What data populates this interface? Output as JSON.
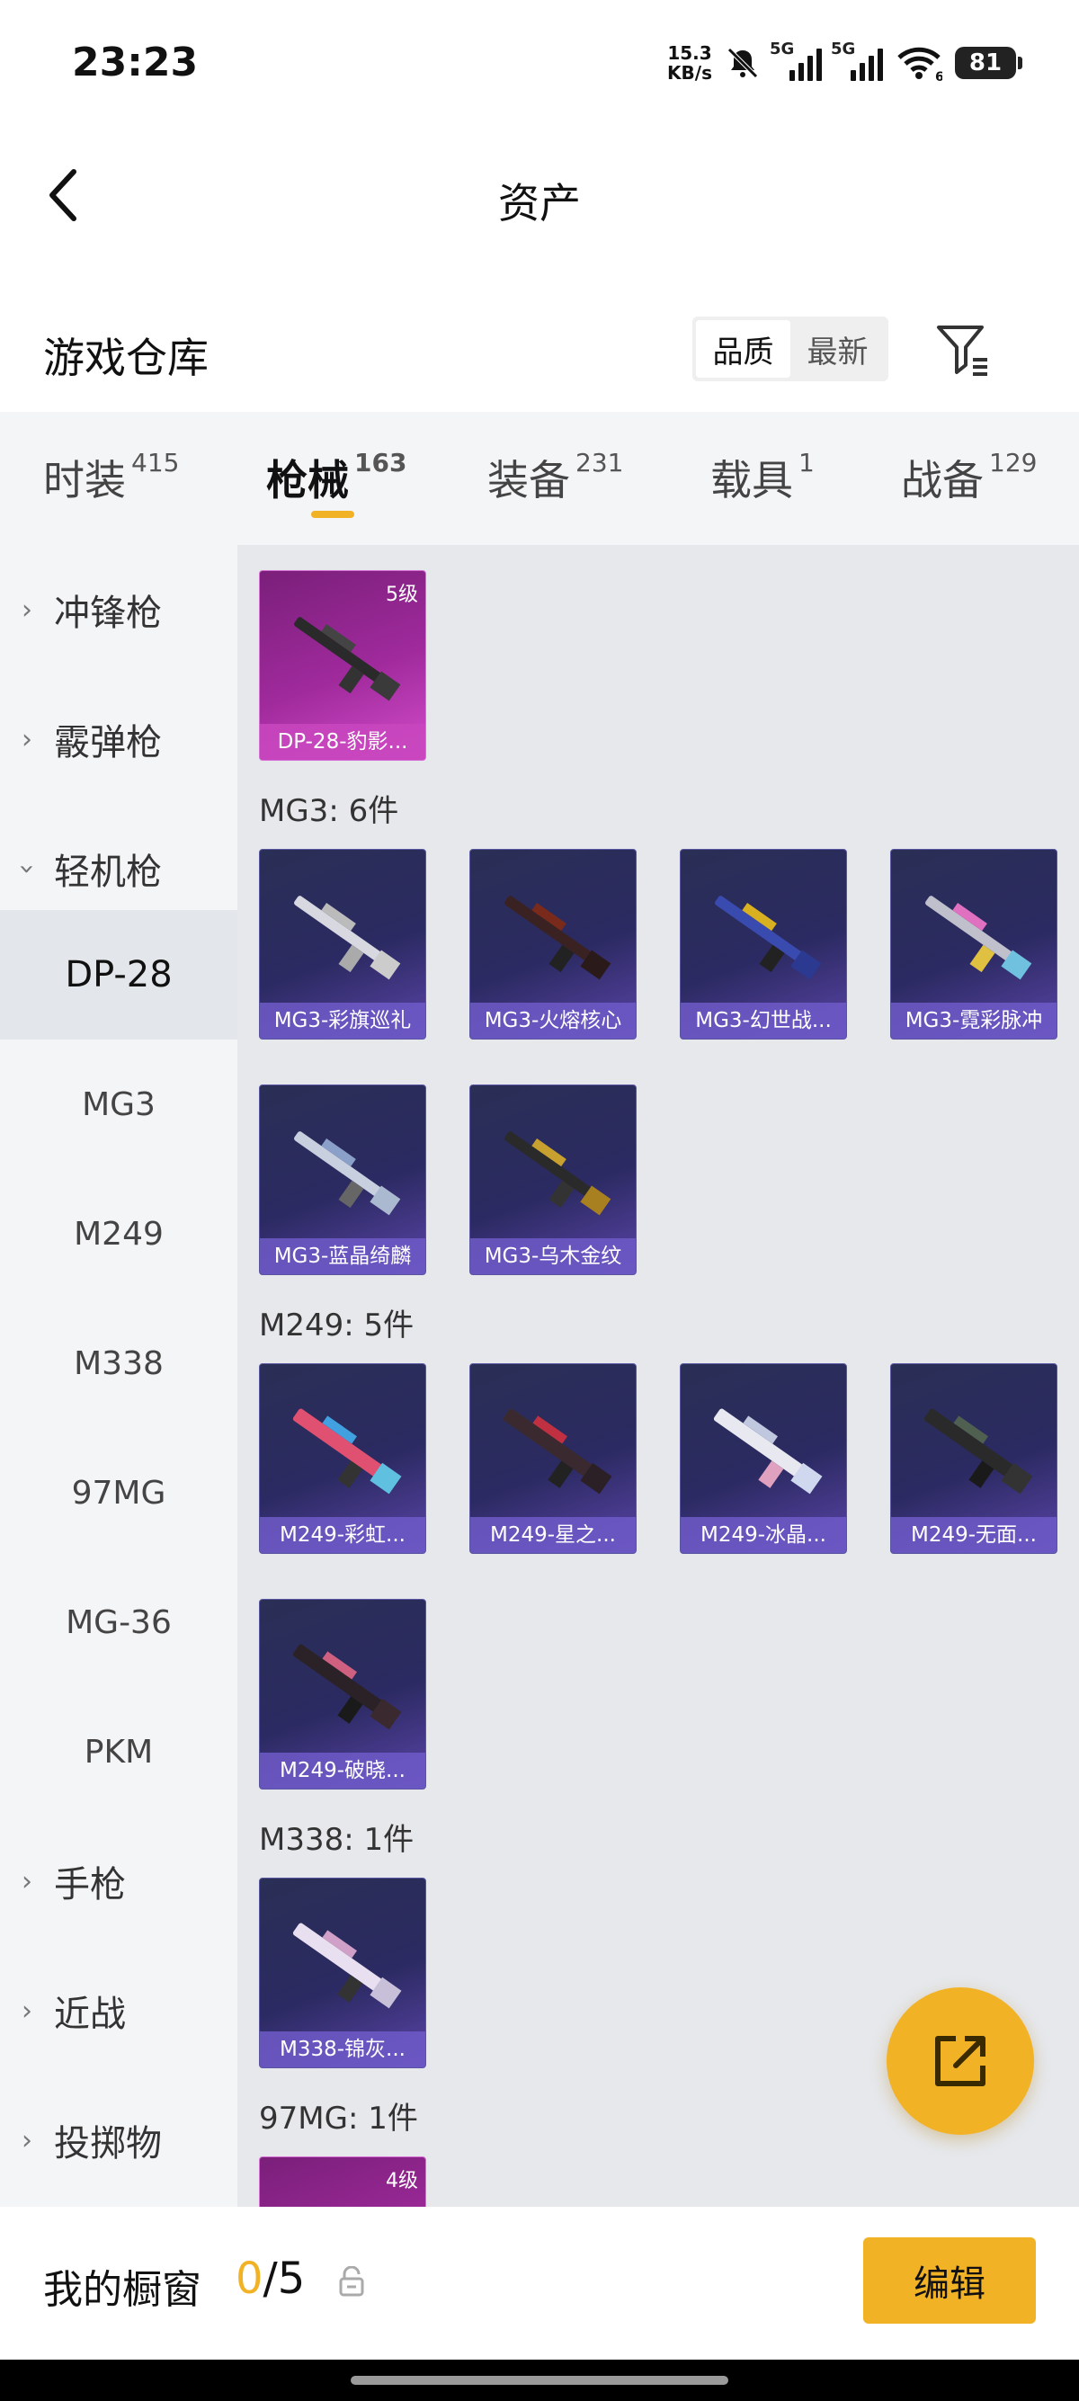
{
  "status": {
    "time": "23:23",
    "net_speed": "15.3",
    "net_unit": "KB/s",
    "signal1_label": "5G",
    "signal2_label": "5G",
    "wifi_label": "6",
    "battery": "81"
  },
  "header": {
    "title": "资产"
  },
  "warehouse": {
    "title": "游戏仓库",
    "sort_options": [
      "品质",
      "最新"
    ]
  },
  "tabs": [
    {
      "label": "时装",
      "count": "415"
    },
    {
      "label": "枪械",
      "count": "163"
    },
    {
      "label": "装备",
      "count": "231"
    },
    {
      "label": "载具",
      "count": "1"
    },
    {
      "label": "战备",
      "count": "129"
    }
  ],
  "sidebar": {
    "categories_top": [
      "冲锋枪",
      "霰弹枪",
      "轻机枪"
    ],
    "subitems": [
      "DP-28",
      "MG3",
      "M249",
      "M338",
      "97MG",
      "MG-36",
      "PKM"
    ],
    "categories_bottom": [
      "手枪",
      "近战",
      "投掷物"
    ]
  },
  "content": {
    "dp28": {
      "badge": "5级",
      "name": "DP-28-豹影..."
    },
    "mg3_label": "MG3: 6件",
    "mg3": [
      "MG3-彩旗巡礼",
      "MG3-火熔核心",
      "MG3-幻世战...",
      "MG3-霓彩脉冲",
      "MG3-蓝晶绮麟",
      "MG3-乌木金纹"
    ],
    "m249_label": "M249: 5件",
    "m249": [
      "M249-彩虹...",
      "M249-星之...",
      "M249-冰晶...",
      "M249-无面...",
      "M249-破晓..."
    ],
    "m338_label": "M338: 1件",
    "m338": [
      "M338-锦灰..."
    ],
    "97mg_label": "97MG: 1件",
    "97mg_badge": "4级"
  },
  "bottom": {
    "showcase_label": "我的橱窗",
    "showcase_current": "0",
    "showcase_total": "/5",
    "edit_label": "编辑"
  }
}
